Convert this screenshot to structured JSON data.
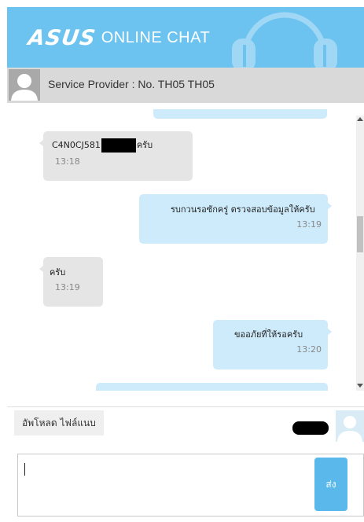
{
  "header": {
    "brand": "ASUS",
    "title": "ONLINE CHAT"
  },
  "provider": {
    "label": "Service Provider : No. TH05 TH05"
  },
  "messages": [
    {
      "direction": "in",
      "text_before": "C4N0CJ581",
      "text_after": "ครับ",
      "time": "13:18"
    },
    {
      "direction": "out",
      "text": "รบกวนรอซักครู่ ตรวจสอบข้อมูลให้ครับ",
      "time": "13:19"
    },
    {
      "direction": "in",
      "text": "ครับ",
      "time": "13:19"
    },
    {
      "direction": "out",
      "text": "ขออภัยที่ให้รอครับ",
      "time": "13:20"
    }
  ],
  "footer": {
    "upload_label": "อัพโหลด ไฟล์แนบ",
    "send_label": "ส่ง"
  },
  "icons": {
    "headset": "headset-icon",
    "avatar": "user-silhouette-icon"
  },
  "colors": {
    "header_bg": "#6cc3ef",
    "outgoing_bubble": "#cdebfb",
    "incoming_bubble": "#e5e5e5",
    "send_button": "#5ab8ea"
  }
}
